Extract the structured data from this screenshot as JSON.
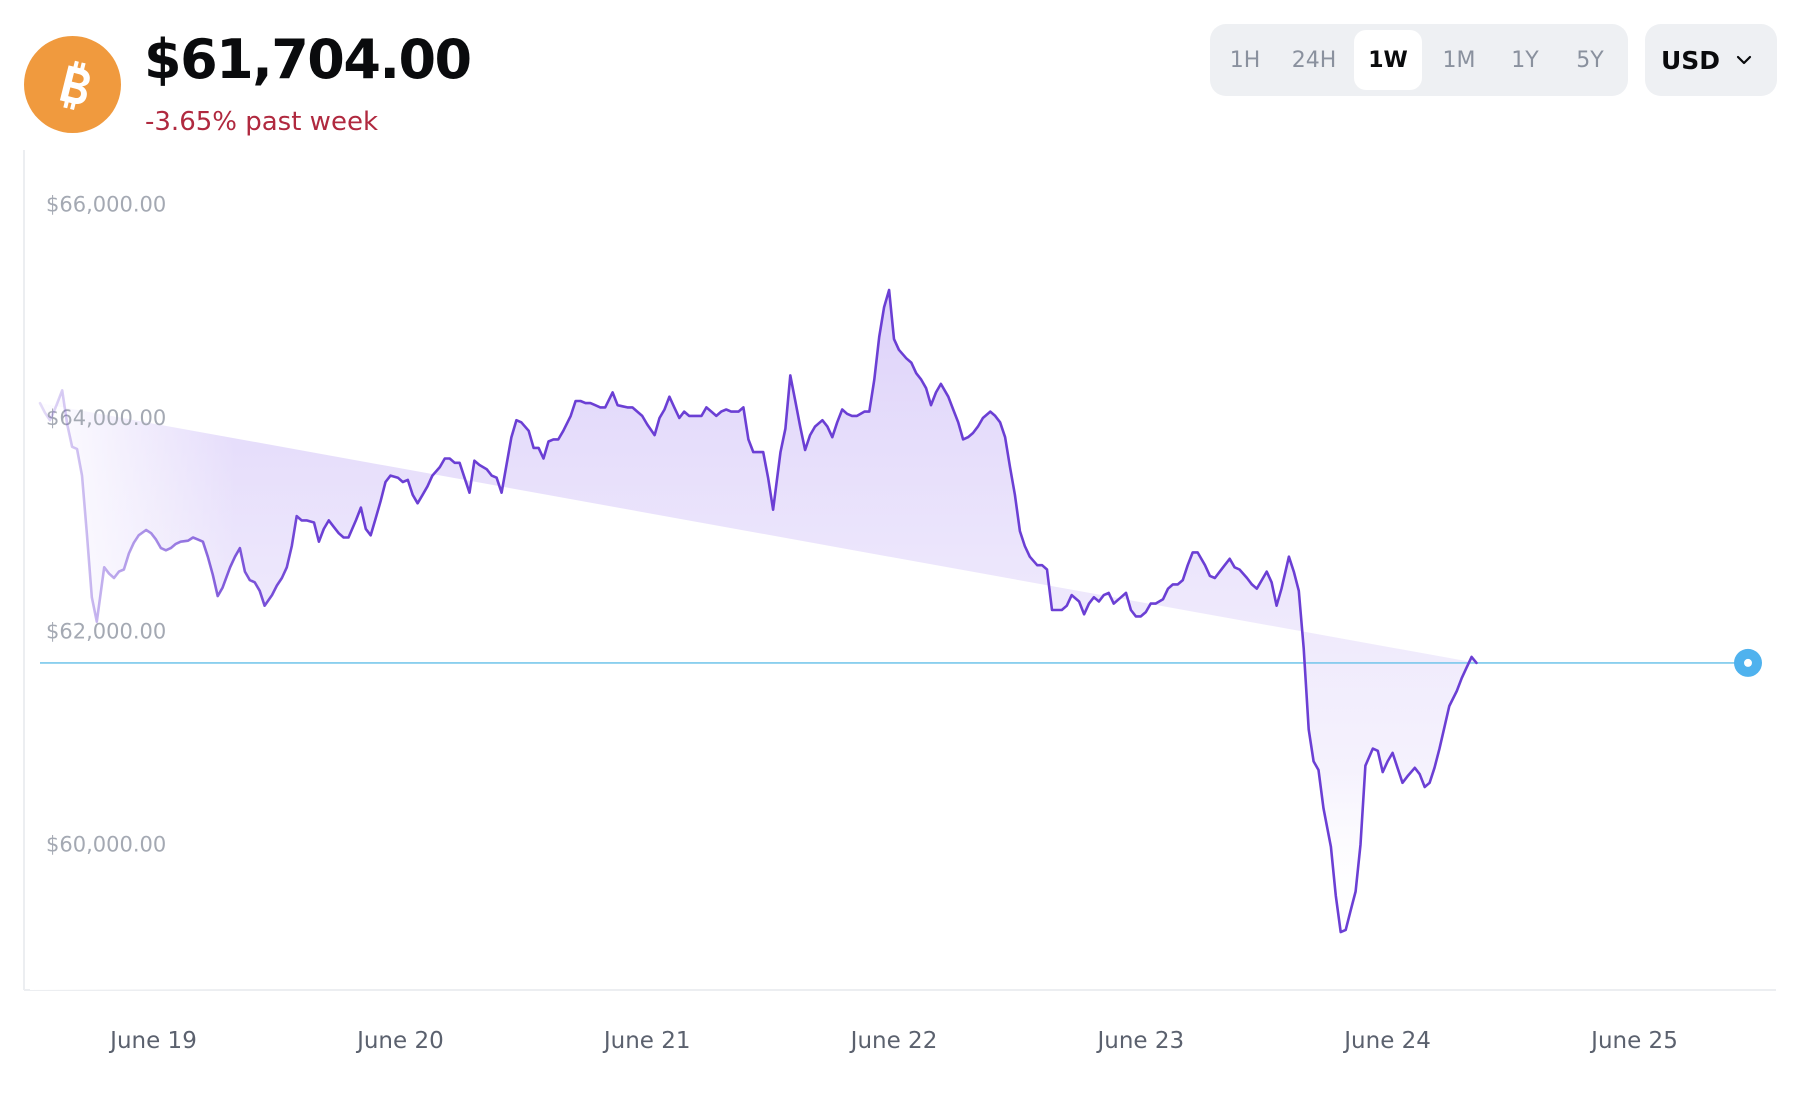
{
  "asset": {
    "icon": "bitcoin-icon",
    "price": "$61,704.00",
    "change": "-3.65% past week",
    "change_color": "#b0293f",
    "brand_color": "#f09a3e"
  },
  "range_selector": {
    "options": [
      "1H",
      "24H",
      "1W",
      "1M",
      "1Y",
      "5Y"
    ],
    "selected": "1W"
  },
  "currency": {
    "selected": "USD"
  },
  "chart_data": {
    "type": "area",
    "y_tick_labels": [
      "$66,000.00",
      "$64,000.00",
      "$62,000.00",
      "$60,000.00"
    ],
    "y_tick_values": [
      66000,
      64000,
      62000,
      60000
    ],
    "ylim": [
      58680,
      66140
    ],
    "x_tick_labels": [
      "June 19",
      "June 20",
      "June 21",
      "June 22",
      "June 23",
      "June 24",
      "June 25"
    ],
    "current_price": 61704,
    "line_color": "#6b3fd4",
    "current_line_color": "#7ac8ec",
    "current_dot_color": "#4fb2ee",
    "grid": false,
    "x_range": [
      -0.46,
      6.46
    ],
    "x": [
      -0.46,
      -0.44,
      -0.42,
      -0.4,
      -0.37,
      -0.35,
      -0.33,
      -0.31,
      -0.29,
      -0.27,
      -0.25,
      -0.23,
      -0.2,
      -0.18,
      -0.16,
      -0.14,
      -0.12,
      -0.1,
      -0.08,
      -0.06,
      -0.03,
      -0.01,
      0.01,
      0.03,
      0.05,
      0.07,
      0.09,
      0.11,
      0.14,
      0.16,
      0.18,
      0.2,
      0.22,
      0.24,
      0.26,
      0.28,
      0.31,
      0.33,
      0.35,
      0.37,
      0.39,
      0.41,
      0.43,
      0.45,
      0.48,
      0.5,
      0.52,
      0.54,
      0.56,
      0.58,
      0.6,
      0.62,
      0.65,
      0.67,
      0.69,
      0.71,
      0.73,
      0.75,
      0.77,
      0.79,
      0.82,
      0.84,
      0.86,
      0.88,
      0.9,
      0.92,
      0.94,
      0.96,
      0.99,
      1.01,
      1.03,
      1.05,
      1.07,
      1.09,
      1.11,
      1.13,
      1.16,
      1.18,
      1.2,
      1.22,
      1.24,
      1.26,
      1.28,
      1.3,
      1.32,
      1.35,
      1.37,
      1.39,
      1.41,
      1.43,
      1.45,
      1.47,
      1.49,
      1.52,
      1.54,
      1.56,
      1.58,
      1.6,
      1.62,
      1.64,
      1.66,
      1.69,
      1.71,
      1.73,
      1.75,
      1.77,
      1.79,
      1.81,
      1.83,
      1.86,
      1.88,
      1.9,
      1.92,
      1.94,
      1.96,
      1.98,
      2.0,
      2.03,
      2.05,
      2.07,
      2.09,
      2.11,
      2.13,
      2.15,
      2.17,
      2.2,
      2.22,
      2.24,
      2.26,
      2.28,
      2.3,
      2.32,
      2.34,
      2.37,
      2.39,
      2.41,
      2.43,
      2.45,
      2.47,
      2.49,
      2.51,
      2.54,
      2.56,
      2.58,
      2.6,
      2.62,
      2.64,
      2.66,
      2.68,
      2.71,
      2.73,
      2.75,
      2.77,
      2.79,
      2.81,
      2.83,
      2.85,
      2.88,
      2.9,
      2.92,
      2.94,
      2.96,
      2.98,
      3.0,
      3.02,
      3.05,
      3.07,
      3.09,
      3.11,
      3.13,
      3.15,
      3.17,
      3.19,
      3.22,
      3.24,
      3.26,
      3.28,
      3.3,
      3.32,
      3.34,
      3.36,
      3.39,
      3.41,
      3.43,
      3.45,
      3.47,
      3.49,
      3.51,
      3.53,
      3.55,
      3.58,
      3.6,
      3.62,
      3.64,
      3.66,
      3.68,
      3.7,
      3.72,
      3.75,
      3.77,
      3.79,
      3.81,
      3.83,
      3.85,
      3.87,
      3.89,
      3.92,
      3.94,
      3.96,
      3.98,
      4.0,
      4.02,
      4.04,
      4.06,
      4.09,
      4.11,
      4.13,
      4.15,
      4.17,
      4.19,
      4.21,
      4.23,
      4.26,
      4.28,
      4.3,
      4.32,
      4.34,
      4.36,
      4.38,
      4.4,
      4.43,
      4.45,
      4.47,
      4.49,
      4.51,
      4.53,
      4.55,
      4.57,
      4.6,
      4.62,
      4.64,
      4.66,
      4.68,
      4.7,
      4.72,
      4.74,
      4.77,
      4.79,
      4.81,
      4.83,
      4.85,
      4.87,
      4.89,
      4.91,
      4.94,
      4.96,
      4.98,
      5.0,
      5.02,
      5.04,
      5.06,
      5.08,
      5.11,
      5.13,
      5.15,
      5.17,
      5.19,
      5.21,
      5.23,
      5.25,
      5.28,
      5.3,
      5.32,
      5.34,
      5.36,
      5.38,
      5.4,
      5.42,
      5.45,
      5.47,
      5.49,
      5.51,
      5.53,
      5.55,
      5.57,
      5.59,
      5.62,
      5.64,
      5.66,
      5.68,
      5.7,
      5.72,
      5.74,
      5.76,
      5.78,
      5.81,
      5.83,
      5.85,
      5.87,
      5.89,
      5.91,
      5.93,
      5.95,
      5.98,
      6.0,
      6.02,
      6.04,
      6.06,
      6.08,
      6.1,
      6.12,
      6.15,
      6.17,
      6.19,
      6.21,
      6.23,
      6.25,
      6.27,
      6.29,
      6.32,
      6.34,
      6.36,
      6.38,
      6.4,
      6.42,
      6.44,
      6.46
    ],
    "values": [
      64140,
      64050,
      63980,
      64080,
      64260,
      63940,
      63730,
      63710,
      63460,
      62910,
      62320,
      62090,
      62600,
      62540,
      62500,
      62560,
      62580,
      62730,
      62830,
      62900,
      62950,
      62920,
      62860,
      62780,
      62760,
      62780,
      62820,
      62840,
      62850,
      62880,
      62860,
      62840,
      62700,
      62530,
      62330,
      62410,
      62600,
      62700,
      62780,
      62560,
      62480,
      62460,
      62380,
      62240,
      62340,
      62430,
      62500,
      62600,
      62800,
      63080,
      63040,
      63040,
      63020,
      62840,
      62960,
      63040,
      62980,
      62920,
      62880,
      62880,
      63040,
      63160,
      62960,
      62900,
      63060,
      63220,
      63400,
      63460,
      63440,
      63400,
      63420,
      63280,
      63200,
      63280,
      63360,
      63460,
      63540,
      63620,
      63620,
      63580,
      63580,
      63440,
      63300,
      63600,
      63560,
      63520,
      63460,
      63440,
      63300,
      63560,
      63820,
      63980,
      63960,
      63880,
      63720,
      63720,
      63620,
      63780,
      63800,
      63800,
      63880,
      64020,
      64160,
      64160,
      64140,
      64140,
      64120,
      64100,
      64100,
      64240,
      64120,
      64110,
      64100,
      64100,
      64060,
      64020,
      63940,
      63840,
      64000,
      64080,
      64200,
      64100,
      64000,
      64060,
      64020,
      64020,
      64020,
      64100,
      64060,
      64020,
      64060,
      64080,
      64060,
      64060,
      64100,
      63800,
      63680,
      63680,
      63680,
      63440,
      63140,
      63680,
      63900,
      64400,
      64160,
      63920,
      63700,
      63840,
      63920,
      63980,
      63920,
      63820,
      63960,
      64080,
      64040,
      64020,
      64020,
      64060,
      64060,
      64360,
      64760,
      65040,
      65200,
      64740,
      64640,
      64560,
      64520,
      64420,
      64360,
      64280,
      64120,
      64240,
      64320,
      64200,
      64080,
      63960,
      63800,
      63820,
      63860,
      63920,
      64000,
      64060,
      64020,
      63960,
      63820,
      63540,
      63280,
      62940,
      62800,
      62700,
      62620,
      62620,
      62580,
      62200,
      62200,
      62200,
      62240,
      62340,
      62280,
      62160,
      62260,
      62320,
      62280,
      62340,
      62360,
      62260,
      62320,
      62360,
      62200,
      62140,
      62140,
      62180,
      62260,
      62260,
      62300,
      62400,
      62440,
      62440,
      62480,
      62620,
      62740,
      62740,
      62620,
      62520,
      62500,
      62560,
      62620,
      62680,
      62600,
      62580,
      62500,
      62440,
      62400,
      62480,
      62560,
      62460,
      62240,
      62400,
      62700,
      62560,
      62380,
      61840,
      61080,
      60780,
      60700,
      60340,
      59980,
      59520,
      59180,
      59200,
      59380,
      59560,
      60000,
      60740,
      60900,
      60880,
      60680,
      60780,
      60860,
      60720,
      60580,
      60640,
      60720,
      60660,
      60540,
      60580,
      60720,
      60900,
      61100,
      61300,
      61440,
      61560,
      61660,
      61760,
      61704
    ]
  }
}
